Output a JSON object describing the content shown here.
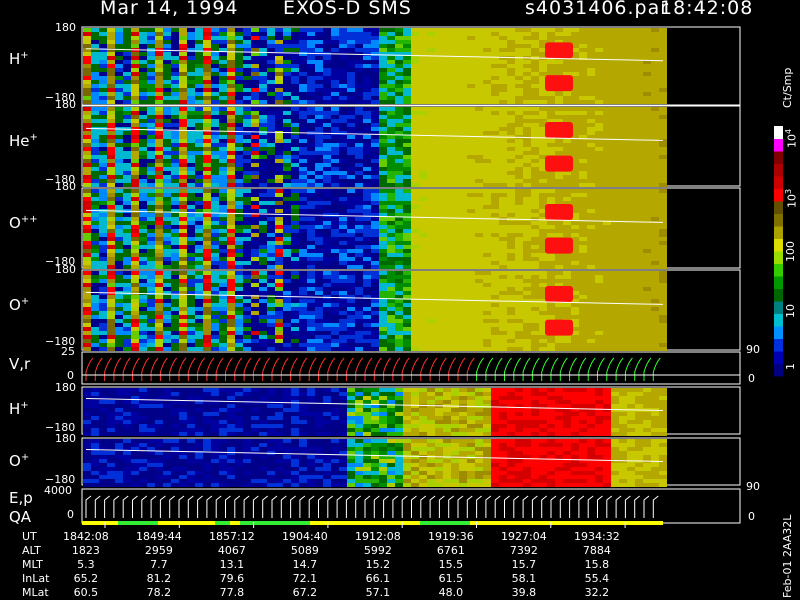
{
  "header": {
    "date": "Mar 14, 1994",
    "instrument": "EXOS-D SMS",
    "file": "s4031406.par",
    "time": "18:42:08"
  },
  "panels": [
    {
      "id": "h_plus",
      "label": "H",
      "sup": "+",
      "ytop": "180",
      "ybot": "−180"
    },
    {
      "id": "he_plus",
      "label": "He",
      "sup": "+",
      "ytop": "180",
      "ybot": "−180"
    },
    {
      "id": "o_pp",
      "label": "O",
      "sup": "++",
      "ytop": "180",
      "ybot": "−180"
    },
    {
      "id": "o_plus",
      "label": "O",
      "sup": "+",
      "ytop": "180",
      "ybot": "−180"
    },
    {
      "id": "vr",
      "label": "V,r",
      "sup": "",
      "ytop": "25",
      "ybot": "0",
      "rtop": "90",
      "rbot": "0"
    },
    {
      "id": "h_plus_2",
      "label": "H",
      "sup": "+",
      "ytop": "180",
      "ybot": "−180"
    },
    {
      "id": "o_plus_2",
      "label": "O",
      "sup": "+",
      "ytop": "180",
      "ybot": "−180",
      "rtop": "90"
    },
    {
      "id": "ep",
      "label": "E,p",
      "label2": "QA",
      "sup": "",
      "ytop": "4000",
      "ybot": "0",
      "rbot": "0"
    }
  ],
  "colorbar": {
    "unit": "Ct/Smp",
    "labels": [
      {
        "base": "10",
        "exp": "4"
      },
      {
        "base": "10",
        "exp": "3"
      },
      {
        "base": "100",
        "exp": ""
      },
      {
        "base": "10",
        "exp": ""
      },
      {
        "base": "1",
        "exp": ""
      }
    ],
    "colors": [
      "#000080",
      "#0000b0",
      "#0030e0",
      "#0090ff",
      "#00c0d0",
      "#008080",
      "#006600",
      "#009900",
      "#33cc00",
      "#99dd00",
      "#dddd00",
      "#aaa000",
      "#807000",
      "#605000",
      "#ff0000",
      "#cc0000",
      "#aa0000",
      "#800000",
      "#ff00ff",
      "#ffffff"
    ]
  },
  "footer": {
    "rows": [
      {
        "label": "UT",
        "values": [
          "1842:08",
          "1849:44",
          "1857:12",
          "1904:40",
          "1912:08",
          "1919:36",
          "1927:04",
          "1934:32"
        ]
      },
      {
        "label": "ALT",
        "values": [
          "1823",
          "2959",
          "4067",
          "5089",
          "5992",
          "6761",
          "7392",
          "7884"
        ]
      },
      {
        "label": "MLT",
        "values": [
          "5.3",
          "7.7",
          "13.1",
          "14.7",
          "15.2",
          "15.5",
          "15.7",
          "15.8"
        ]
      },
      {
        "label": "InLat",
        "values": [
          "65.2",
          "81.2",
          "79.6",
          "72.1",
          "66.1",
          "61.5",
          "58.1",
          "55.4"
        ]
      },
      {
        "label": "MLat",
        "values": [
          "60.5",
          "78.2",
          "77.8",
          "67.2",
          "57.1",
          "48.0",
          "39.8",
          "32.2"
        ]
      }
    ],
    "side_label": "Feb-01  2AA32L"
  },
  "chart_data": {
    "type": "heatmap",
    "title": "Mar 14, 1994   EXOS-D SMS",
    "subtitle": "s4031406.par  18:42:08",
    "x_ticks": [
      "1842:08",
      "1849:44",
      "1857:12",
      "1904:40",
      "1912:08",
      "1919:36",
      "1927:04",
      "1934:32"
    ],
    "x_unit": "UT",
    "color_scale": "log",
    "color_range": [
      1,
      10000
    ],
    "colorbar_label": "Ct/Smp",
    "series": [
      {
        "name": "H+",
        "y_range": [
          -180,
          180
        ]
      },
      {
        "name": "He+",
        "y_range": [
          -180,
          180
        ]
      },
      {
        "name": "O++",
        "y_range": [
          -180,
          180
        ]
      },
      {
        "name": "O+",
        "y_range": [
          -180,
          180
        ]
      },
      {
        "name": "V,r",
        "y_range": [
          0,
          25
        ],
        "y2_range": [
          0,
          90
        ]
      },
      {
        "name": "H+",
        "y_range": [
          -180,
          180
        ]
      },
      {
        "name": "O+",
        "y_range": [
          -180,
          180
        ]
      },
      {
        "name": "E,p",
        "y_range": [
          0,
          4000
        ],
        "y2_range": [
          0,
          90
        ]
      }
    ]
  }
}
